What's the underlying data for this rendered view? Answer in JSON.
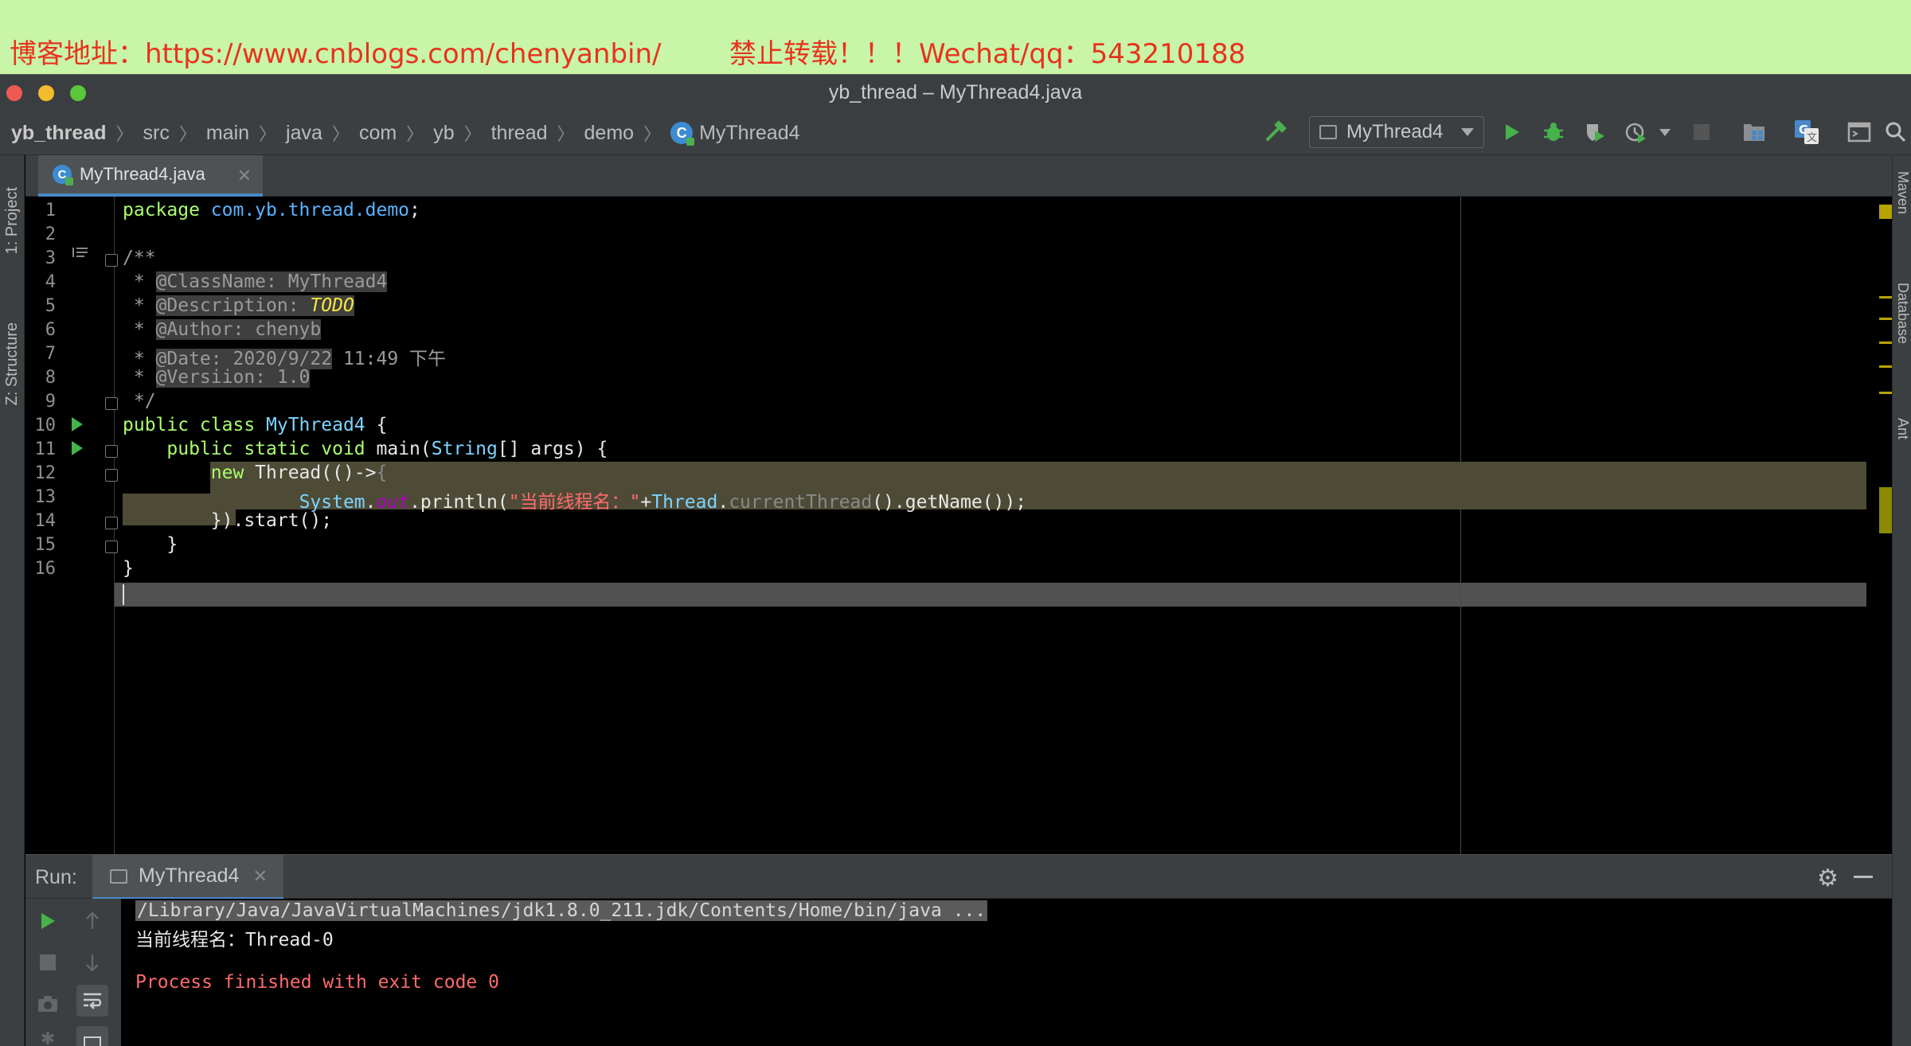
{
  "banner": {
    "blog": "博客地址：https://www.cnblogs.com/chenyanbin/",
    "notice": "禁止转载！！！Wechat/qq：543210188"
  },
  "window": {
    "title": "yb_thread – MyThread4.java"
  },
  "breadcrumb": {
    "items": [
      "yb_thread",
      "src",
      "main",
      "java",
      "com",
      "yb",
      "thread",
      "demo",
      "MyThread4"
    ]
  },
  "toolbar": {
    "run_config": "MyThread4",
    "icons": [
      "build-hammer-icon",
      "run-icon",
      "debug-icon",
      "coverage-icon",
      "profile-icon",
      "stop-icon",
      "project-structure-icon",
      "translate-icon",
      "terminal-icon",
      "search-icon"
    ]
  },
  "left_tools": {
    "project": "1: Project",
    "structure": "Z: Structure"
  },
  "right_tools": {
    "maven": "Maven",
    "database": "Database",
    "ant": "Ant"
  },
  "editor": {
    "tab_label": "MyThread4.java",
    "line_numbers": [
      "1",
      "2",
      "3",
      "4",
      "5",
      "6",
      "7",
      "8",
      "9",
      "10",
      "11",
      "12",
      "13",
      "14",
      "15",
      "16"
    ],
    "code": {
      "l1_kw": "package ",
      "l1_pkg": "com.yb.thread.demo",
      "l1_semi": ";",
      "l3": "/**",
      "l4_star": " * ",
      "l4_tag": "@ClassName: MyThread4",
      "l5_star": " * ",
      "l5_tag": "@Description: ",
      "l5_todo": "TODO",
      "l6_star": " * ",
      "l6_tag": "@Author: chenyb",
      "l7_star": " * ",
      "l7_tag": "@Date: 2020/9/22",
      "l7_rest": " 11:49 下午",
      "l8_star": " * ",
      "l8_tag": "@Versiion: 1.0",
      "l9": " */",
      "l10_kw": "public class ",
      "l10_cls": "MyThread4",
      "l10_rest": " {",
      "l11_indent": "    ",
      "l11_kw": "public static void ",
      "l11_main": "main(",
      "l11_str": "String",
      "l11_rest": "[] args) {",
      "l12_indent": "        ",
      "l12_kw": "new ",
      "l12_rest": "Thread(()->",
      "l12_brace": "{",
      "l13_indent": "                ",
      "l13_sys": "System",
      "l13_dot": ".",
      "l13_out": "out",
      "l13_print": ".println(",
      "l13_str": "\"当前线程名：\"",
      "l13_plus": "+",
      "l13_thread": "Thread",
      "l13_dot2": ".",
      "l13_ct": "currentThread",
      "l13_end": "().getName());",
      "l14_indent": "        ",
      "l14_code": "}).start();",
      "l15": "    }",
      "l16": "}"
    }
  },
  "run": {
    "label": "Run:",
    "tab_label": "MyThread4",
    "console": {
      "cmd": "/Library/Java/JavaVirtualMachines/jdk1.8.0_211.jdk/Contents/Home/bin/java ...",
      "output": "当前线程名：Thread-0",
      "exit": "Process finished with exit code 0"
    }
  },
  "colors": {
    "banner_bg": "#c8f5a8",
    "banner_text": "#e8321e",
    "run_green": "#45b34a",
    "highlight": "#4d4a36"
  }
}
